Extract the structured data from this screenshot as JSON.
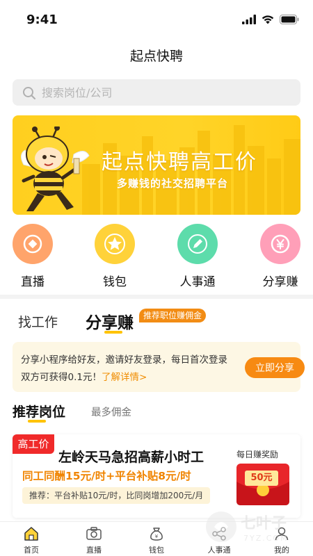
{
  "status_bar": {
    "time": "9:41"
  },
  "app_title": "起点快聘",
  "search": {
    "placeholder": "搜索岗位/公司"
  },
  "banner": {
    "title": "起点快聘高工价",
    "subtitle": "多赚钱的社交招聘平台",
    "accent_color": "#ffcf1f"
  },
  "categories": [
    {
      "label": "直播",
      "icon": "coin-icon",
      "color": "#ffa46b"
    },
    {
      "label": "钱包",
      "icon": "star-icon",
      "color": "#ffd23a"
    },
    {
      "label": "人事通",
      "icon": "pencil-icon",
      "color": "#5ddcab"
    },
    {
      "label": "分享赚",
      "icon": "yuan-icon",
      "color": "#ff9fb8"
    }
  ],
  "tabs": {
    "find_job": "找工作",
    "share_earn": "分享赚",
    "badge": "推荐职位赚佣金"
  },
  "notice": {
    "text": "分享小程序给好友，邀请好友登录，每日首次登录双方可获得0.1元！",
    "link": "了解详情>",
    "button": "立即分享"
  },
  "recommend": {
    "title": "推荐岗位",
    "secondary_tab": "最多佣金"
  },
  "job_card": {
    "tag": "高工价",
    "title": "左岭天马急招高薪小时工",
    "salary": "同工同酬15元/时+平台补贴8元/时",
    "recommend": "推荐：平台补贴10元/时，比同岗增加200元/月",
    "reward_label": "每日赚奖励",
    "reward_amount": "50元"
  },
  "bottom_nav": [
    {
      "label": "首页",
      "icon": "home-icon",
      "active": true
    },
    {
      "label": "直播",
      "icon": "camera-icon"
    },
    {
      "label": "钱包",
      "icon": "wallet-bag-icon"
    },
    {
      "label": "人事通",
      "icon": "share-network-icon"
    },
    {
      "label": "我的",
      "icon": "user-icon"
    }
  ],
  "watermark": {
    "text": "七叶子",
    "subtext": "7YZ.COM"
  }
}
